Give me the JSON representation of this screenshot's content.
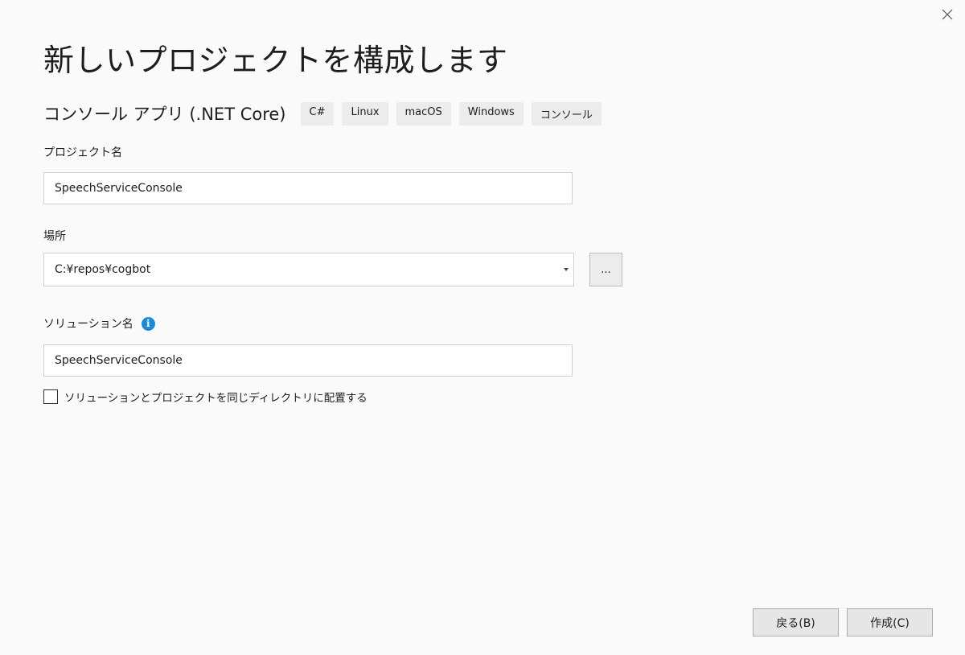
{
  "dialog": {
    "title": "新しいプロジェクトを構成します",
    "close_icon": "close-icon"
  },
  "template": {
    "name": "コンソール アプリ (.NET Core)",
    "tags": [
      "C#",
      "Linux",
      "macOS",
      "Windows",
      "コンソール"
    ]
  },
  "project_name": {
    "label": "プロジェクト名",
    "value": "SpeechServiceConsole"
  },
  "location": {
    "label": "場所",
    "value": "C:¥repos¥cogbot",
    "browse_label": "..."
  },
  "solution_name": {
    "label": "ソリューション名",
    "info_icon": "info-icon",
    "info_glyph": "i",
    "value": "SpeechServiceConsole"
  },
  "same_directory": {
    "label": "ソリューションとプロジェクトを同じディレクトリに配置する",
    "checked": false
  },
  "footer": {
    "back_label": "戻る(B)",
    "create_label": "作成(C)"
  },
  "colors": {
    "background": "#fafafa",
    "info_accent": "#1e8ad6",
    "tag_bg": "#ececec"
  }
}
